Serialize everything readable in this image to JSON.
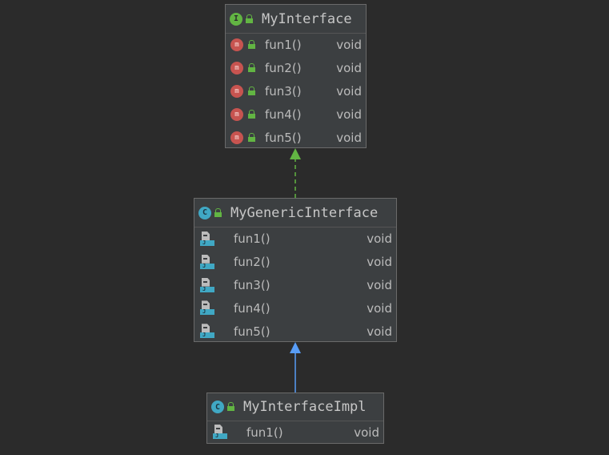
{
  "diagram": {
    "nodes": [
      {
        "id": "my-interface",
        "name": "MyInterface",
        "kind": "interface",
        "icon": "interface-icon",
        "badge_letter": "I",
        "methods": [
          {
            "name": "fun1()",
            "type": "void"
          },
          {
            "name": "fun2()",
            "type": "void"
          },
          {
            "name": "fun3()",
            "type": "void"
          },
          {
            "name": "fun4()",
            "type": "void"
          },
          {
            "name": "fun5()",
            "type": "void"
          }
        ]
      },
      {
        "id": "my-generic-interface",
        "name": "MyGenericInterface",
        "kind": "class",
        "icon": "class-icon",
        "badge_letter": "C",
        "methods": [
          {
            "name": "fun1()",
            "type": "void"
          },
          {
            "name": "fun2()",
            "type": "void"
          },
          {
            "name": "fun3()",
            "type": "void"
          },
          {
            "name": "fun4()",
            "type": "void"
          },
          {
            "name": "fun5()",
            "type": "void"
          }
        ]
      },
      {
        "id": "my-interface-impl",
        "name": "MyInterfaceImpl",
        "kind": "class",
        "icon": "class-icon",
        "badge_letter": "C",
        "methods": [
          {
            "name": "fun1()",
            "type": "void"
          }
        ]
      }
    ],
    "edges": [
      {
        "from": "my-generic-interface",
        "to": "my-interface",
        "relation": "implements",
        "style": "dashed",
        "color": "#62b543"
      },
      {
        "from": "my-interface-impl",
        "to": "my-generic-interface",
        "relation": "extends",
        "style": "solid",
        "color": "#589df6"
      }
    ],
    "icons": {
      "interface_method": "abstract-method-icon",
      "implemented_method": "implemented-method-icon",
      "visibility": "public-lock-icon"
    },
    "colors": {
      "background": "#2b2b2b",
      "node_fill": "#3c3f41",
      "node_border": "#6a6a6a",
      "interface_badge": "#62b543",
      "class_badge": "#40a8c4",
      "method_badge": "#c75450"
    }
  }
}
